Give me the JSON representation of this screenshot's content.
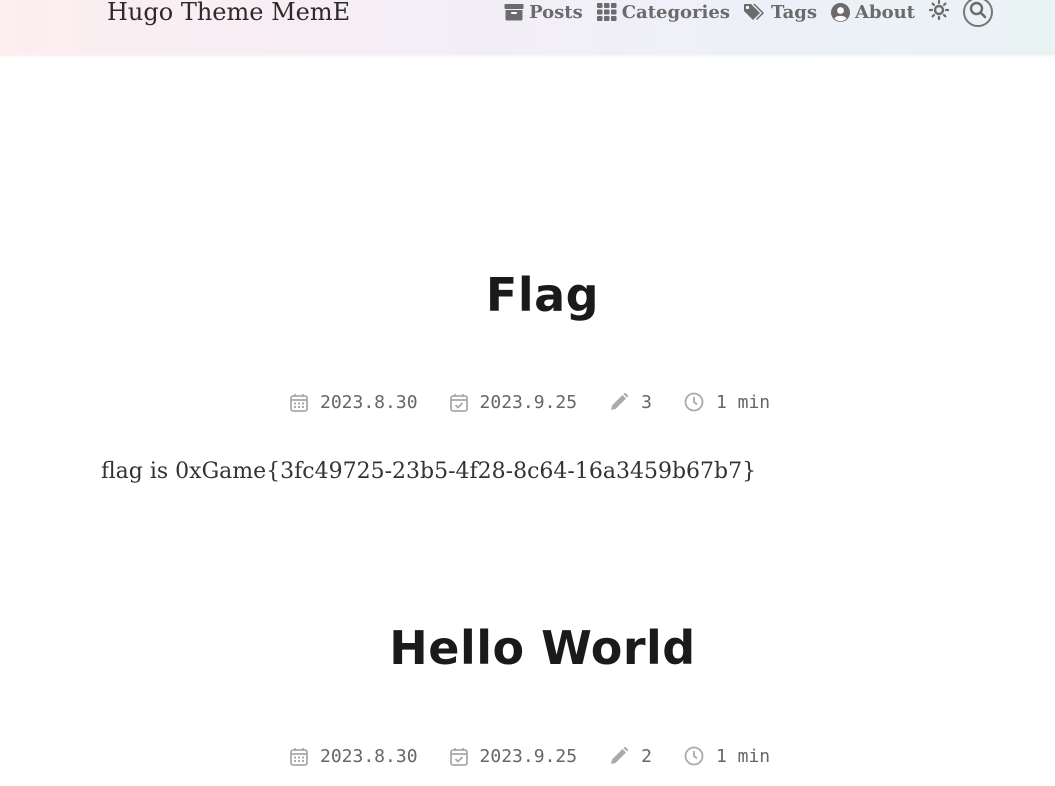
{
  "header": {
    "site_title": "Hugo Theme MemE",
    "nav": [
      {
        "label": "Posts",
        "icon": "archive-icon"
      },
      {
        "label": "Categories",
        "icon": "grid-icon"
      },
      {
        "label": "Tags",
        "icon": "tags-icon"
      },
      {
        "label": "About",
        "icon": "user-circle-icon"
      }
    ],
    "theme_toggle_icon": "sun-icon",
    "search_icon": "search-icon"
  },
  "posts": [
    {
      "title": "Flag",
      "published": "2023.8.30",
      "updated": "2023.9.25",
      "edits": "3",
      "read_time": "1 min",
      "summary": "flag is 0xGame{3fc49725-23b5-4f28-8c64-16a3459b67b7}"
    },
    {
      "title": "Hello World",
      "published": "2023.8.30",
      "updated": "2023.9.25",
      "edits": "2",
      "read_time": "1 min"
    }
  ],
  "colors": {
    "text": "#222222",
    "meta": "#666666",
    "nav": "#6b6b6b"
  }
}
